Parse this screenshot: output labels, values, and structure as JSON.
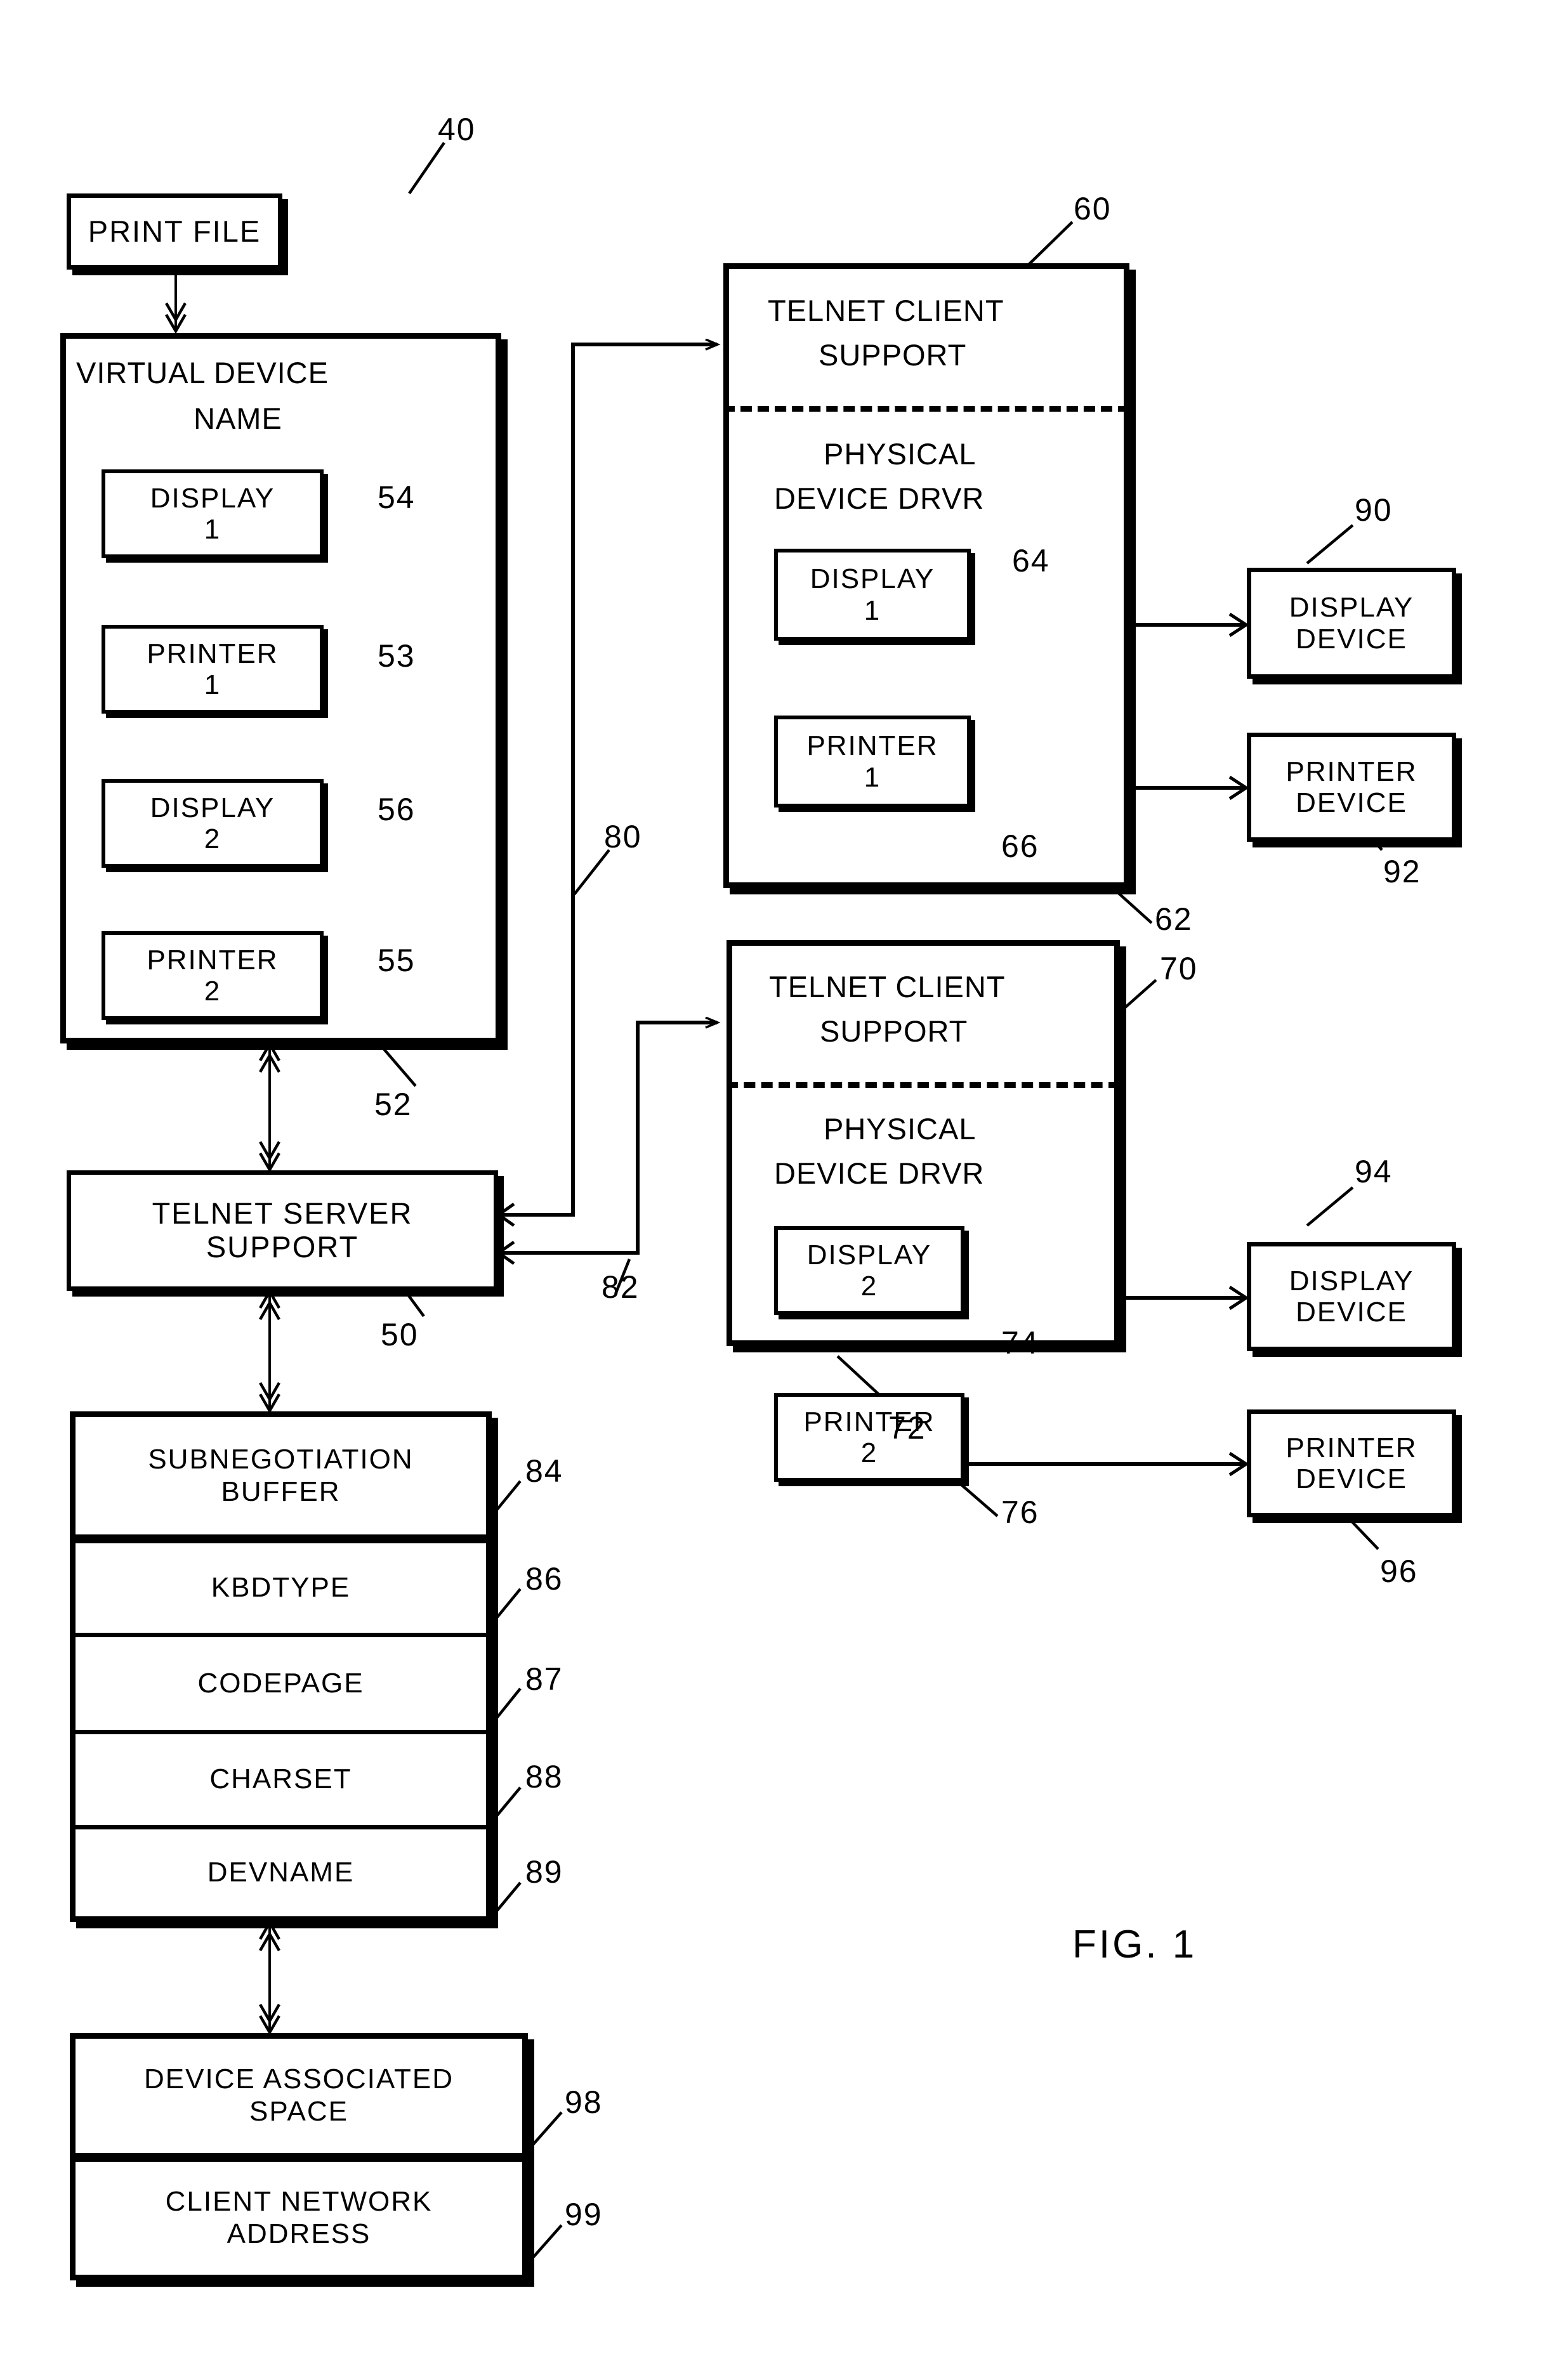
{
  "figure": {
    "caption": "FIG. 1"
  },
  "nodes": {
    "print_file": {
      "label": "PRINT FILE",
      "ref": "40"
    },
    "virtual_device_name": {
      "title_line1": "VIRTUAL DEVICE",
      "title_line2": "NAME",
      "ref": "52",
      "items": [
        {
          "line1": "DISPLAY",
          "line2": "1",
          "ref": "54"
        },
        {
          "line1": "PRINTER",
          "line2": "1",
          "ref": "53"
        },
        {
          "line1": "DISPLAY",
          "line2": "2",
          "ref": "56"
        },
        {
          "line1": "PRINTER",
          "line2": "2",
          "ref": "55"
        }
      ]
    },
    "telnet_server_support": {
      "line1": "TELNET SERVER",
      "line2": "SUPPORT",
      "ref": "50"
    },
    "subnegotiation_buffer": {
      "header_line1": "SUBNEGOTIATION",
      "header_line2": "BUFFER",
      "ref": "84",
      "fields": [
        {
          "label": "KBDTYPE",
          "ref": "86"
        },
        {
          "label": "CODEPAGE",
          "ref": "87"
        },
        {
          "label": "CHARSET",
          "ref": "88"
        },
        {
          "label": "DEVNAME",
          "ref": "89"
        }
      ]
    },
    "device_associated_space": {
      "header_line1": "DEVICE ASSOCIATED",
      "header_line2": "SPACE",
      "ref": "98",
      "fields": [
        {
          "line1": "CLIENT NETWORK",
          "line2": "ADDRESS",
          "ref": "99"
        }
      ]
    },
    "telnet_client_1": {
      "top_line1": "TELNET CLIENT",
      "top_line2": "SUPPORT",
      "bottom_line1": "PHYSICAL",
      "bottom_line2": "DEVICE DRVR",
      "ref_top": "60",
      "ref_bottom": "62",
      "items": [
        {
          "line1": "DISPLAY",
          "line2": "1",
          "ref": "64"
        },
        {
          "line1": "PRINTER",
          "line2": "1",
          "ref": "66"
        }
      ]
    },
    "telnet_client_2": {
      "top_line1": "TELNET CLIENT",
      "top_line2": "SUPPORT",
      "bottom_line1": "PHYSICAL",
      "bottom_line2": "DEVICE DRVR",
      "ref_top": "70",
      "ref_bottom": "72",
      "items": [
        {
          "line1": "DISPLAY",
          "line2": "2",
          "ref": "74"
        },
        {
          "line1": "PRINTER",
          "line2": "2",
          "ref": "76"
        }
      ]
    },
    "display_device_1": {
      "line1": "DISPLAY",
      "line2": "DEVICE",
      "ref": "90"
    },
    "printer_device_1": {
      "line1": "PRINTER",
      "line2": "DEVICE",
      "ref": "92"
    },
    "display_device_2": {
      "line1": "DISPLAY",
      "line2": "DEVICE",
      "ref": "94"
    },
    "printer_device_2": {
      "line1": "PRINTER",
      "line2": "DEVICE",
      "ref": "96"
    }
  },
  "connectors": [
    {
      "ref": "80",
      "from": "telnet_server_support",
      "to": "telnet_client_1"
    },
    {
      "ref": "82",
      "from": "telnet_server_support",
      "to": "telnet_client_2"
    }
  ],
  "colors": {
    "ink": "#000000",
    "paper": "#ffffff"
  }
}
